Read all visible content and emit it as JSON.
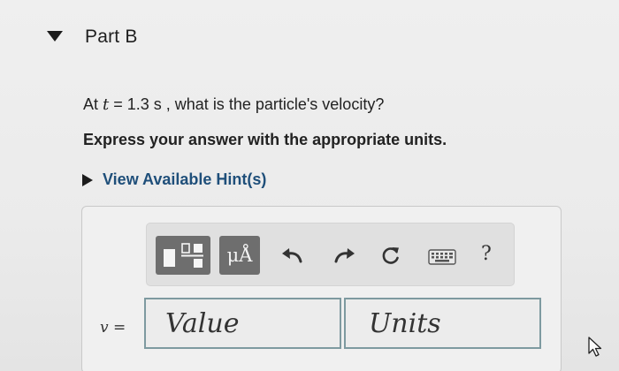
{
  "part": {
    "title": "Part B"
  },
  "question": {
    "prefix": "At ",
    "variable": "t",
    "equals_value": " = 1.3 s , what is the particle's velocity?"
  },
  "instruction": "Express your answer with the appropriate units.",
  "hint": {
    "label": "View Available Hint(s)"
  },
  "toolbar": {
    "templates_icon": "fraction-templates-icon",
    "units_label": "μÅ",
    "undo_icon": "undo-arrow-icon",
    "redo_icon": "redo-arrow-icon",
    "reset_icon": "reset-icon",
    "keyboard_icon": "keyboard-icon",
    "help_label": "?"
  },
  "answer": {
    "variable": "v",
    "equals": " =",
    "value_placeholder": "Value",
    "units_placeholder": "Units"
  },
  "colors": {
    "hint_link": "#1f4f7a",
    "toolbar_button_dark": "#6e6e6e",
    "input_border": "#7e9aa0"
  }
}
